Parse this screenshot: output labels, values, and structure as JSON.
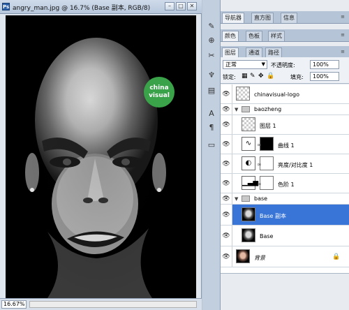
{
  "document": {
    "app_icon": "Ps",
    "title": "angry_man.jpg @ 16.7% (Base 副本, RGB/8)",
    "zoom": "16.67%",
    "window_buttons": [
      "minimize",
      "maximize",
      "close"
    ]
  },
  "dock": {
    "tools": [
      "brush-preset-icon",
      "clone-source-icon",
      "tool-presets-icon",
      "character-icon",
      "paragraph-icon",
      "notes-icon"
    ]
  },
  "watermark": {
    "text_line1": "china",
    "text_line2": "visual"
  },
  "panel_groups": {
    "group1_tabs": [
      "导航器",
      "直方图",
      "信息"
    ],
    "group2_tabs": [
      "颜色",
      "色板",
      "样式"
    ],
    "group3_tabs": [
      "图层",
      "通道",
      "路径"
    ]
  },
  "layer_options": {
    "blend_mode": "正常",
    "opacity_label": "不透明度:",
    "opacity_value": "100%",
    "lock_label": "锁定:",
    "fill_label": "填充:",
    "fill_value": "100%"
  },
  "layers": [
    {
      "name": "chinavisual-logo",
      "type": "layer",
      "thumb": "checker"
    },
    {
      "name": "baozheng",
      "type": "group"
    },
    {
      "name": "图层 1",
      "type": "layer",
      "thumb": "checker"
    },
    {
      "name": "曲线 1",
      "type": "adjustment",
      "icon": "curves-icon"
    },
    {
      "name": "亮度/对比度 1",
      "type": "adjustment",
      "icon": "brightness-contrast-icon"
    },
    {
      "name": "色阶 1",
      "type": "adjustment",
      "icon": "levels-icon"
    },
    {
      "name": "base",
      "type": "group"
    },
    {
      "name": "Base 副本",
      "type": "layer",
      "thumb": "face",
      "selected": true
    },
    {
      "name": "Base",
      "type": "layer",
      "thumb": "face"
    },
    {
      "name": "背景",
      "type": "background",
      "thumb": "face-color",
      "locked": true
    }
  ]
}
